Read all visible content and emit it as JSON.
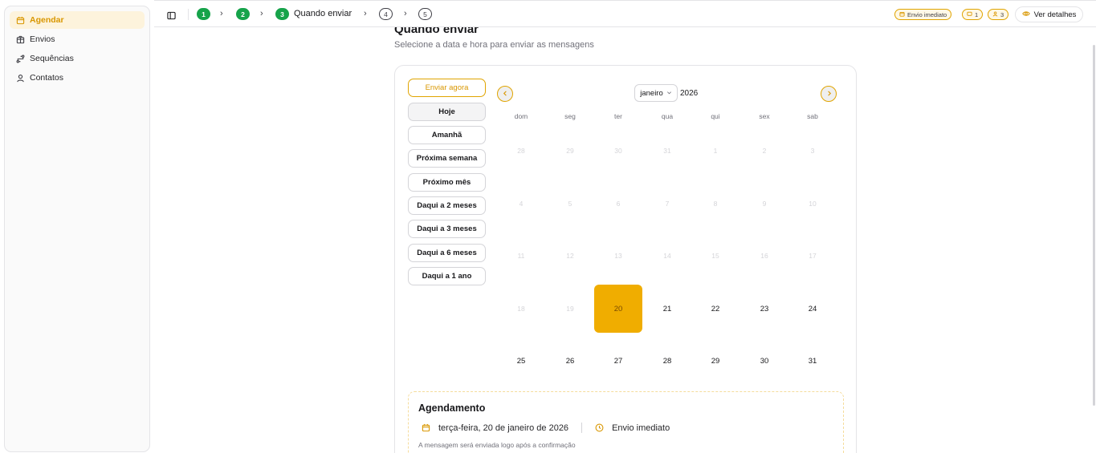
{
  "sidebar": {
    "items": [
      {
        "label": "Agendar",
        "icon": "calendar-icon"
      },
      {
        "label": "Envios",
        "icon": "package-icon"
      },
      {
        "label": "Sequências",
        "icon": "route-icon"
      },
      {
        "label": "Contatos",
        "icon": "user-icon"
      }
    ]
  },
  "stepper": {
    "steps": [
      {
        "num": "1"
      },
      {
        "num": "2"
      },
      {
        "num": "3",
        "label": "Quando enviar"
      },
      {
        "num": "4"
      },
      {
        "num": "5"
      }
    ],
    "chevron": "›"
  },
  "badges": {
    "mode": "Envio imediato",
    "messages": "1",
    "contacts": "3"
  },
  "details_button": "Ver detalhes",
  "page": {
    "title": "Quando enviar",
    "subtitle": "Selecione a data e hora para enviar as mensagens"
  },
  "quick_options": [
    "Enviar agora",
    "Hoje",
    "Amanhã",
    "Próxima semana",
    "Próximo mês",
    "Daqui a 2 meses",
    "Daqui a 3 meses",
    "Daqui a 6 meses",
    "Daqui a 1 ano"
  ],
  "calendar": {
    "month": "janeiro",
    "year": "2026",
    "weekdays": [
      "dom",
      "seg",
      "ter",
      "qua",
      "qui",
      "sex",
      "sab"
    ],
    "weeks": [
      [
        "28",
        "29",
        "30",
        "31",
        "1",
        "2",
        "3"
      ],
      [
        "4",
        "5",
        "6",
        "7",
        "8",
        "9",
        "10"
      ],
      [
        "11",
        "12",
        "13",
        "14",
        "15",
        "16",
        "17"
      ],
      [
        "18",
        "19",
        "20",
        "21",
        "22",
        "23",
        "24"
      ],
      [
        "25",
        "26",
        "27",
        "28",
        "29",
        "30",
        "31"
      ]
    ],
    "selected": "20"
  },
  "schedule": {
    "title": "Agendamento",
    "date": "terça-feira, 20 de janeiro de 2026",
    "time": "Envio imediato",
    "note": "A mensagem será enviada logo após a confirmação"
  },
  "colors": {
    "accent": "#f0ad00",
    "accent_text": "#d99700",
    "done_step": "#16a34a"
  }
}
